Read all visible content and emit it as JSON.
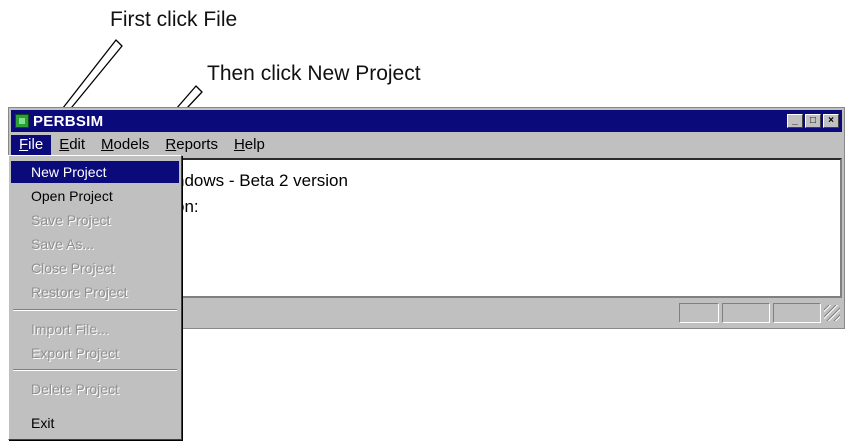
{
  "annotations": {
    "step1": "First click File",
    "step2": "Then click New Project"
  },
  "window": {
    "title": "PERBSIM",
    "controls": {
      "minimize": "_",
      "maximize": "□",
      "close": "×"
    }
  },
  "menubar": {
    "items": [
      {
        "label": "File",
        "mnemonic": "F",
        "rest": "ile"
      },
      {
        "label": "Edit",
        "mnemonic": "E",
        "rest": "dit"
      },
      {
        "label": "Models",
        "mnemonic": "M",
        "rest": "odels"
      },
      {
        "label": "Reports",
        "mnemonic": "R",
        "rest": "eports"
      },
      {
        "label": "Help",
        "mnemonic": "H",
        "rest": "elp"
      }
    ]
  },
  "client": {
    "line1": "ndows - Beta 2 version",
    "line2": "on:"
  },
  "file_menu": {
    "items": [
      {
        "label": "New Project",
        "state": "highlighted"
      },
      {
        "label": "Open Project",
        "state": "enabled"
      },
      {
        "label": "Save Project",
        "state": "disabled"
      },
      {
        "label": "Save As...",
        "state": "disabled"
      },
      {
        "label": "Close Project",
        "state": "disabled"
      },
      {
        "label": "Restore Project",
        "state": "disabled"
      },
      {
        "label": "Import File...",
        "state": "disabled"
      },
      {
        "label": "Export Project",
        "state": "disabled"
      },
      {
        "label": "Delete Project",
        "state": "disabled"
      },
      {
        "label": "Exit",
        "state": "enabled"
      }
    ]
  },
  "colors": {
    "titlebar": "#0a0a7a",
    "highlight": "#0a0a7a",
    "face": "#c0c0c0",
    "disabled_text": "#909090"
  }
}
